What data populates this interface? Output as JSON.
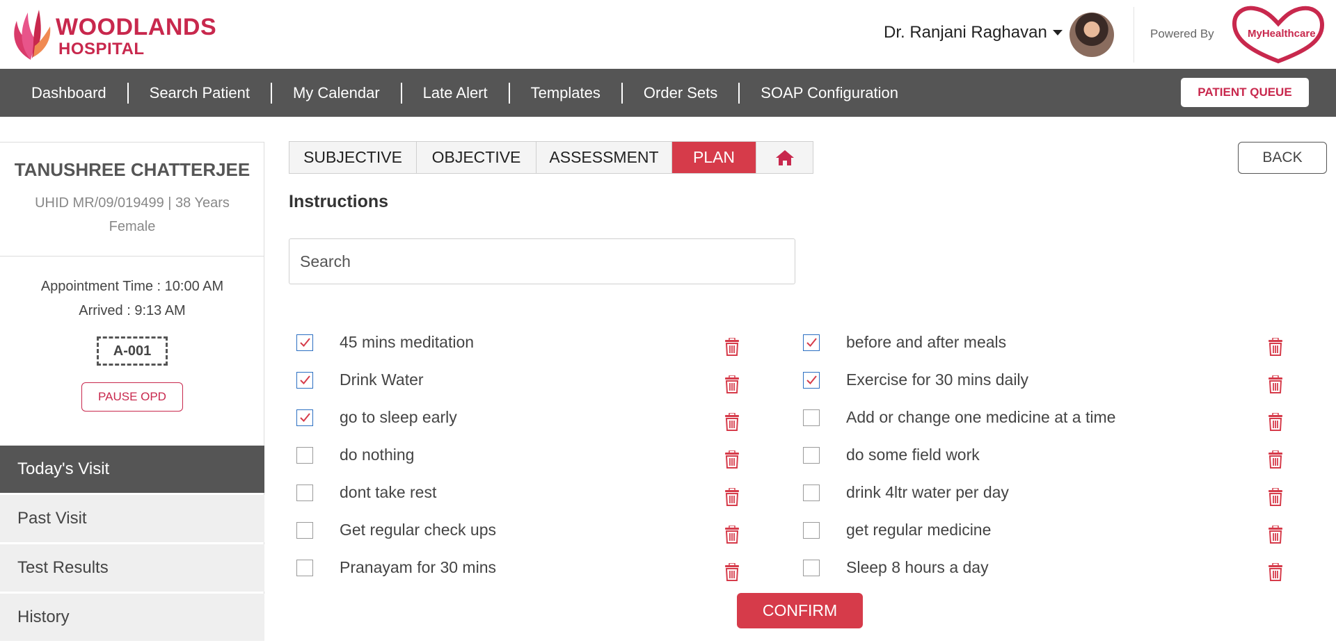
{
  "header": {
    "logo_line1": "WOODLANDS",
    "logo_line2": "HOSPITAL",
    "doctor_name": "Dr. Ranjani Raghavan",
    "powered_by": "Powered By",
    "partner_logo_text": "MyHealthcare"
  },
  "nav": {
    "items": [
      "Dashboard",
      "Search Patient",
      "My Calendar",
      "Late Alert",
      "Templates",
      "Order Sets",
      "SOAP Configuration"
    ],
    "queue_button": "PATIENT QUEUE"
  },
  "patient": {
    "name": "TANUSHREE CHATTERJEE",
    "meta": "UHID MR/09/019499 | 38 Years Female",
    "appointment_time": "Appointment Time : 10:00 AM",
    "arrived": "Arrived : 9:13 AM",
    "token": "A-001",
    "pause_button": "PAUSE OPD"
  },
  "side_menu": [
    "Today's Visit",
    "Past Visit",
    "Test Results",
    "History"
  ],
  "tabs": [
    "SUBJECTIVE",
    "OBJECTIVE",
    "ASSESSMENT",
    "PLAN"
  ],
  "active_tab": "PLAN",
  "back_button": "BACK",
  "section_title": "Instructions",
  "search": {
    "placeholder": "Search",
    "value": ""
  },
  "instructions_left": [
    {
      "label": "45 mins meditation",
      "checked": true
    },
    {
      "label": "Drink Water",
      "checked": true
    },
    {
      "label": "go to sleep early",
      "checked": true
    },
    {
      "label": "do nothing",
      "checked": false
    },
    {
      "label": "dont take rest",
      "checked": false
    },
    {
      "label": "Get regular check ups",
      "checked": false
    },
    {
      "label": "Pranayam for 30 mins",
      "checked": false
    }
  ],
  "instructions_right": [
    {
      "label": "before and after meals",
      "checked": true
    },
    {
      "label": "Exercise for 30 mins daily",
      "checked": true
    },
    {
      "label": "Add or change one medicine at a time",
      "checked": false
    },
    {
      "label": "do some field work",
      "checked": false
    },
    {
      "label": "drink 4ltr water per day",
      "checked": false
    },
    {
      "label": "get regular medicine",
      "checked": false
    },
    {
      "label": "Sleep 8 hours a day",
      "checked": false
    }
  ],
  "confirm_button": "CONFIRM",
  "colors": {
    "accent": "#d63b4a",
    "brand": "#c8284d",
    "nav_bg": "#555555",
    "check": "#2b6fc2"
  }
}
